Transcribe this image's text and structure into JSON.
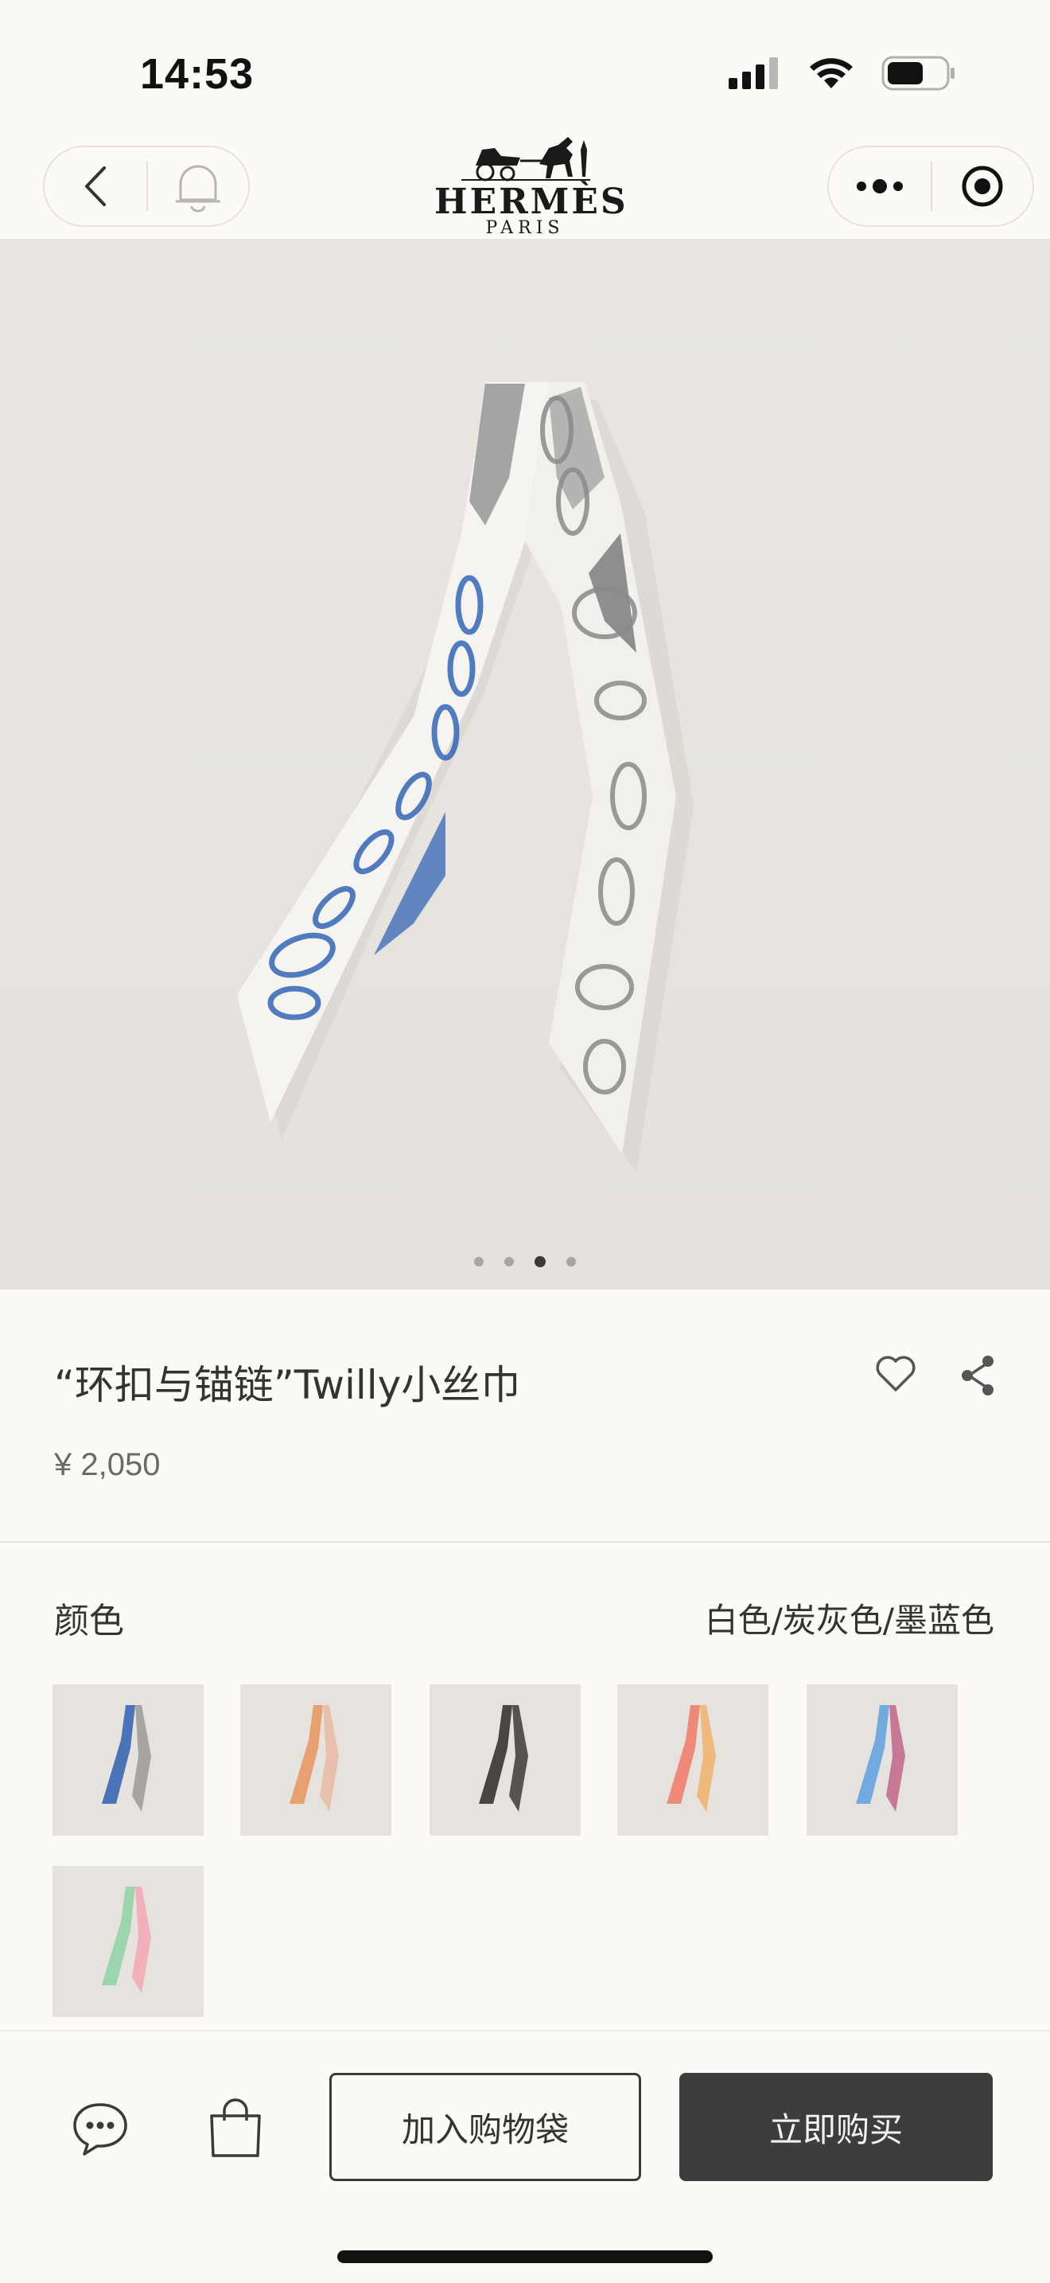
{
  "status_bar": {
    "time": "14:53",
    "icons": [
      "cellular-signal-icon",
      "wifi-icon",
      "battery-icon"
    ]
  },
  "nav": {
    "brand_name": "HERMÈS",
    "brand_sub": "PARIS",
    "icons": [
      "back-arrow-icon",
      "bell-icon",
      "more-dots-icon",
      "close-circle-icon"
    ]
  },
  "gallery": {
    "total_images": 4,
    "active_index": 3
  },
  "product": {
    "title": "“环扣与锚链”Twilly小丝巾",
    "price": "¥ 2,050"
  },
  "color_section": {
    "label": "颜色",
    "selected_value": "白色/炭灰色/墨蓝色",
    "swatches": [
      {
        "name": "white-charcoal-navy",
        "colors": [
          "#2f5fb0",
          "#9a9a9a"
        ],
        "selected": true
      },
      {
        "name": "peach-orange",
        "colors": [
          "#e7945e",
          "#e9b8a4"
        ],
        "selected": false
      },
      {
        "name": "black",
        "colors": [
          "#2a2a2a",
          "#3b3b3b"
        ],
        "selected": false
      },
      {
        "name": "coral-yellow",
        "colors": [
          "#f07a6a",
          "#f0b26a"
        ],
        "selected": false
      },
      {
        "name": "sky-blue",
        "colors": [
          "#5aa0df",
          "#c0658a"
        ],
        "selected": false
      },
      {
        "name": "mint-pink",
        "colors": [
          "#8ed1a4",
          "#f2a7b4"
        ],
        "selected": false
      }
    ]
  },
  "bottom_bar": {
    "add_to_bag_label": "加入购物袋",
    "buy_now_label": "立即购买",
    "icons": [
      "chat-icon",
      "shopping-bag-icon"
    ]
  }
}
